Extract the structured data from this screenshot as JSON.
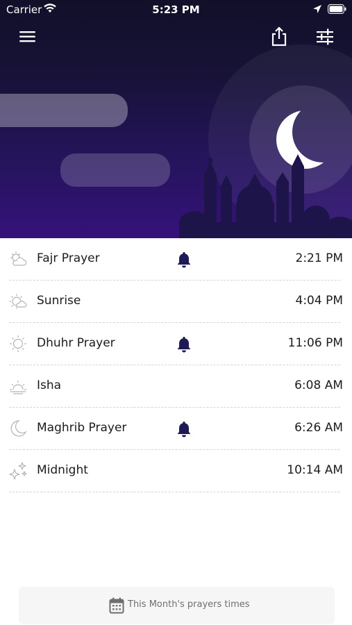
{
  "status_bar": {
    "carrier": "Carrier",
    "time": "5:23 PM"
  },
  "header": {
    "menu_icon": "menu-icon",
    "share_icon": "share-icon",
    "settings_icon": "sliders-icon"
  },
  "prayers": [
    {
      "name": "Fajr Prayer",
      "time": "2:21 PM",
      "icon": "cloud-sun-icon",
      "alarm": true
    },
    {
      "name": "Sunrise",
      "time": "4:04 PM",
      "icon": "sunrise-icon",
      "alarm": false
    },
    {
      "name": "Dhuhr Prayer",
      "time": "11:06 PM",
      "icon": "sun-icon",
      "alarm": true
    },
    {
      "name": "Isha",
      "time": "6:08 AM",
      "icon": "sunset-icon",
      "alarm": false
    },
    {
      "name": "Maghrib Prayer",
      "time": "6:26 AM",
      "icon": "moon-icon",
      "alarm": true
    },
    {
      "name": "Midnight",
      "time": "10:14 AM",
      "icon": "stars-icon",
      "alarm": false
    }
  ],
  "footer": {
    "month_button_label": "This Month's prayers times"
  },
  "colors": {
    "header_top": "#111029",
    "header_bottom": "#35127a",
    "bell": "#1e1a56"
  }
}
